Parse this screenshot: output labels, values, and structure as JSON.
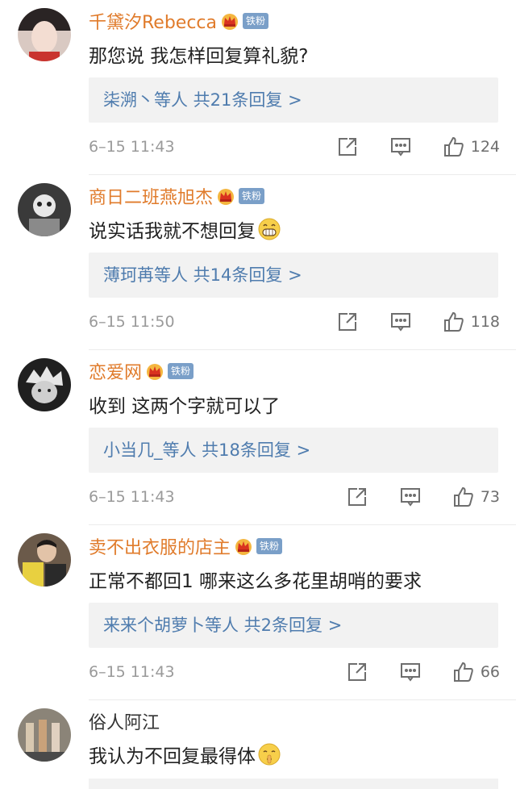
{
  "badge_label": "铁粉",
  "colors": {
    "username": "#e07b2b",
    "reply_link": "#4f7cae",
    "badge": "#7a9fc8",
    "muted": "#9a9a9a"
  },
  "comments": [
    {
      "username": "千黛汐Rebecca",
      "text": "那您说 我怎样回复算礼貌?",
      "replies_label": "柒溯丶等人  共21条回复 >",
      "time": "6–15 11:43",
      "likes": "124",
      "has_crown": true,
      "emoji": ""
    },
    {
      "username": "商日二班燕旭杰",
      "text": "说实话我就不想回复",
      "replies_label": "薄珂苒等人  共14条回复 >",
      "time": "6–15 11:50",
      "likes": "118",
      "has_crown": true,
      "emoji": "grin-emoji"
    },
    {
      "username": "恋爱网",
      "text": "收到  这两个字就可以了",
      "replies_label": "小当几_等人  共18条回复 >",
      "time": "6–15 11:43",
      "likes": "73",
      "has_crown": true,
      "emoji": ""
    },
    {
      "username": "卖不出衣服的店主",
      "text": "正常不都回1 哪来这么多花里胡哨的要求",
      "replies_label": "来来个胡萝卜等人  共2条回复 >",
      "time": "6–15 11:43",
      "likes": "66",
      "has_crown": true,
      "emoji": ""
    },
    {
      "username": "俗人阿江",
      "text": "我认为不回复最得体",
      "has_crown": false,
      "emoji": "hush-emoji"
    }
  ]
}
